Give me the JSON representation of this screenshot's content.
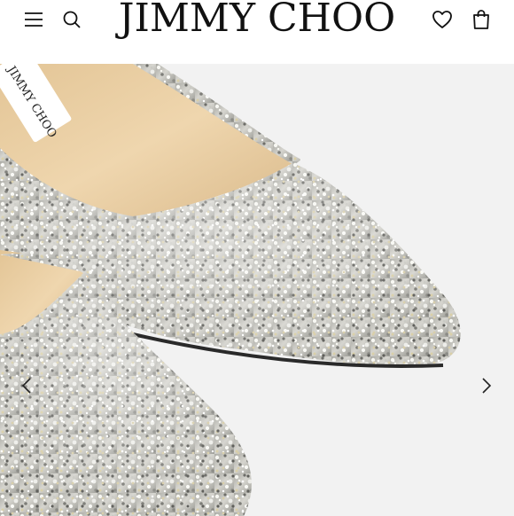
{
  "header": {
    "brand": "JIMMY CHOO",
    "icons": {
      "menu": "menu-icon",
      "search": "search-icon",
      "wishlist": "heart-icon",
      "bag": "shopping-bag-icon"
    }
  },
  "gallery": {
    "label_text": "JIMMY CHOO",
    "prev_icon": "chevron-left-icon",
    "next_icon": "chevron-right-icon",
    "colors": {
      "background": "#f2f2f2",
      "lining": "#e9cfa7",
      "glitter_base": "#bdbdb6"
    }
  }
}
